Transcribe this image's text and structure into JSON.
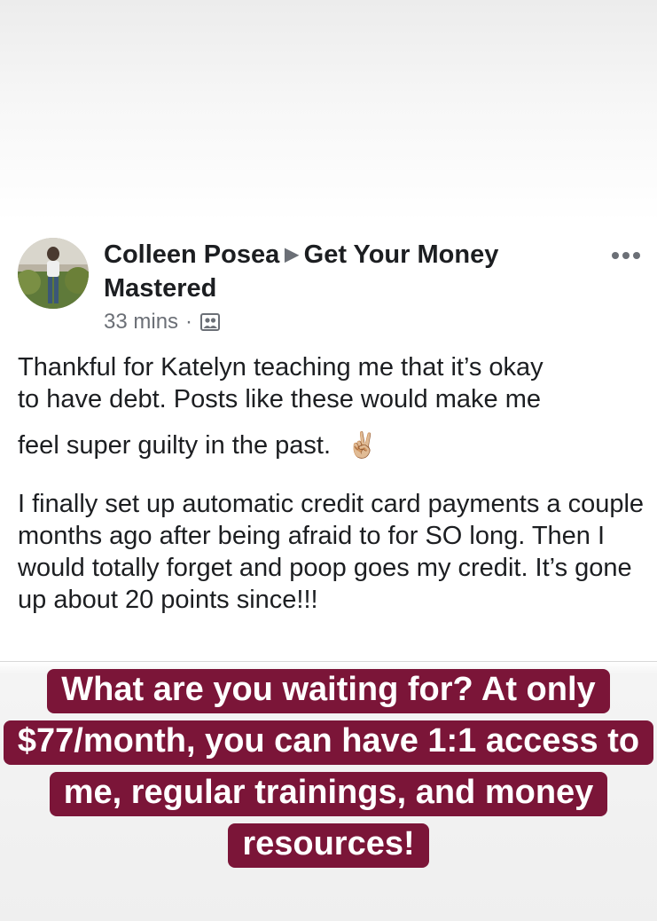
{
  "post": {
    "author": "Colleen Posea",
    "group": "Get Your Money Mastered",
    "timestamp": "33 mins",
    "separator": "·",
    "audience_icon": "group-members-icon",
    "more_icon": "more-options-icon",
    "paragraph1_line1": "Thankful for Katelyn teaching me that it’s okay",
    "paragraph1_line2": "to have debt. Posts like these would make me",
    "paragraph1_line3": "feel super guilty in the past.",
    "emoji": "✌🏼",
    "paragraph2": "I finally set up automatic credit card payments a couple months ago after being afraid to for SO long. Then I would totally forget and poop goes my credit. It’s gone up about 20 points since!!!"
  },
  "promo": {
    "text": "What are you waiting for? At only $77/month, you can have 1:1 access to me, regular trainings, and money resources!",
    "background": "#7b1538",
    "color": "#ffffff"
  }
}
